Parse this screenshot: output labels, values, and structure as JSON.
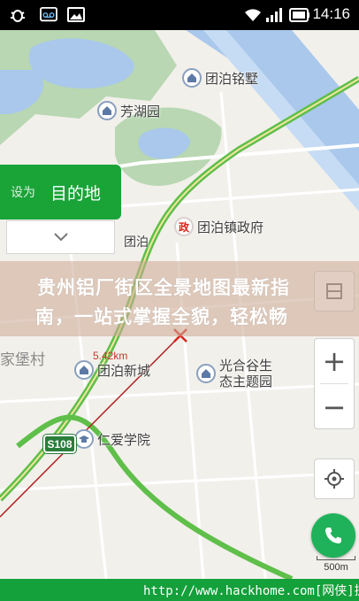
{
  "status_bar": {
    "time": "14:16",
    "icons": [
      "bug-icon",
      "voicemail-icon",
      "image-icon",
      "wifi-icon",
      "signal-icon",
      "battery-icon"
    ]
  },
  "destination_panel": {
    "prefix": "设为",
    "title": "目的地"
  },
  "map": {
    "pois": [
      {
        "name": "团泊铭墅",
        "icon": "residential-icon"
      },
      {
        "name": "芳湖园",
        "icon": "residential-icon"
      },
      {
        "name": "团泊镇政府",
        "icon": "government-icon",
        "badge": "政"
      },
      {
        "name": "团泊新城",
        "icon": "residential-icon"
      },
      {
        "name": "光合谷生态主题园",
        "line1": "光合谷生",
        "line2": "态主题园",
        "icon": "residential-icon"
      },
      {
        "name": "仁爱学院",
        "icon": "school-icon"
      },
      {
        "name": "团泊",
        "icon": "residential-icon"
      }
    ],
    "village_label": "家堡村",
    "distance": "5.42km",
    "road_shield": "S108",
    "scale": "500m"
  },
  "controls": {
    "zoom_in": "+",
    "zoom_out": "−"
  },
  "overlay": {
    "line1": "贵州铝厂街区全景地图最新指",
    "line2": "南，一站式掌握全貌，轻松畅"
  },
  "watermark": "http://www.hackhome.com[网侠]提供",
  "colors": {
    "accent_green": "#1aa438",
    "water": "#a9c8ec",
    "park": "#b8d7b2",
    "route_red": "#b22222"
  }
}
